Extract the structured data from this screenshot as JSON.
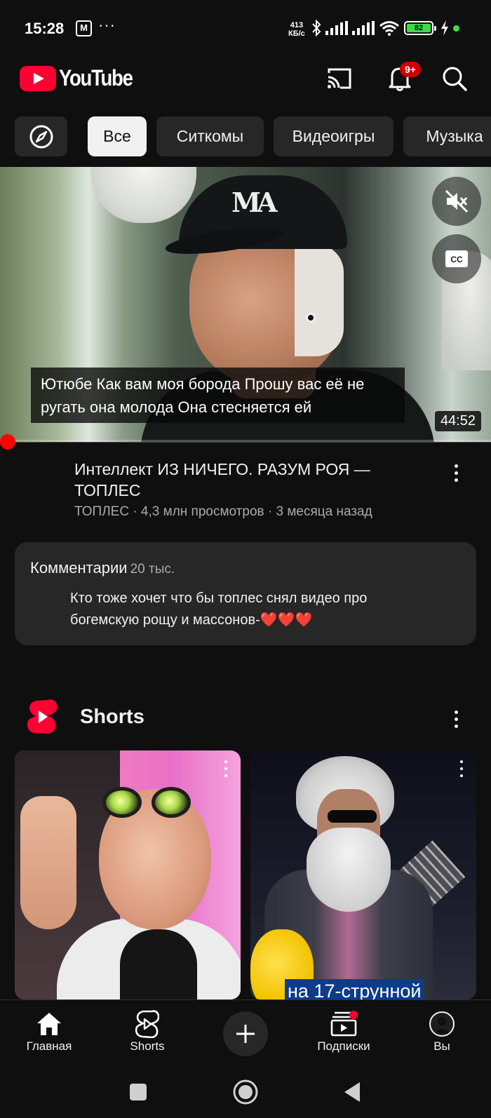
{
  "status_bar": {
    "time": "15:28",
    "m_icon": "M",
    "more_dots": "···",
    "speed_value": "413",
    "speed_unit": "КБ/с",
    "battery_level": "82",
    "icons": [
      "bluetooth-icon",
      "signal-icon",
      "signal-icon",
      "wifi-icon",
      "battery-icon",
      "charging-icon"
    ]
  },
  "header": {
    "logo_text": "YouTube",
    "notifications_badge": "9+",
    "icons": [
      "cast-icon",
      "bell-icon",
      "search-icon"
    ]
  },
  "chips": [
    {
      "label": "",
      "icon": "compass-icon"
    },
    {
      "label": "Все",
      "active": true
    },
    {
      "label": "Ситкомы"
    },
    {
      "label": "Видеоигры"
    },
    {
      "label": "Музыка"
    }
  ],
  "player": {
    "caption": "Ютюбе Как вам моя борода Прошу вас её не ругать она молода Она стесняется ей",
    "duration": "44:52",
    "progress": 0.0,
    "icons": [
      "mute-icon",
      "closed-captions-icon"
    ]
  },
  "video": {
    "title": "Интеллект ИЗ НИЧЕГО. РАЗУМ РОЯ — ТОПЛЕС",
    "meta": "ТОПЛЕС · 4,3 млн просмотров · 3 месяца назад"
  },
  "comments": {
    "title": "Комментарии",
    "count": "20 тыс.",
    "top_comment": "Кто тоже хочет что бы топлес снял видео про богемскую рощу и массонов-❤️❤️❤️"
  },
  "shorts": {
    "section_title": "Shorts",
    "items": [
      {
        "caption": ""
      },
      {
        "caption": "на 17-струнной"
      }
    ]
  },
  "bottom_nav": {
    "items": [
      {
        "label": "Главная",
        "icon": "home-icon"
      },
      {
        "label": "Shorts",
        "icon": "shorts-icon"
      },
      {
        "label": "",
        "icon": "plus-icon"
      },
      {
        "label": "Подписки",
        "icon": "subscriptions-icon"
      },
      {
        "label": "Вы",
        "icon": "account-icon"
      }
    ]
  },
  "colors": {
    "background": "#0f0f0f",
    "chip": "#272727",
    "accent_red": "#ff0033",
    "text_primary": "#f1f1f1",
    "text_secondary": "#aaaaaa"
  }
}
